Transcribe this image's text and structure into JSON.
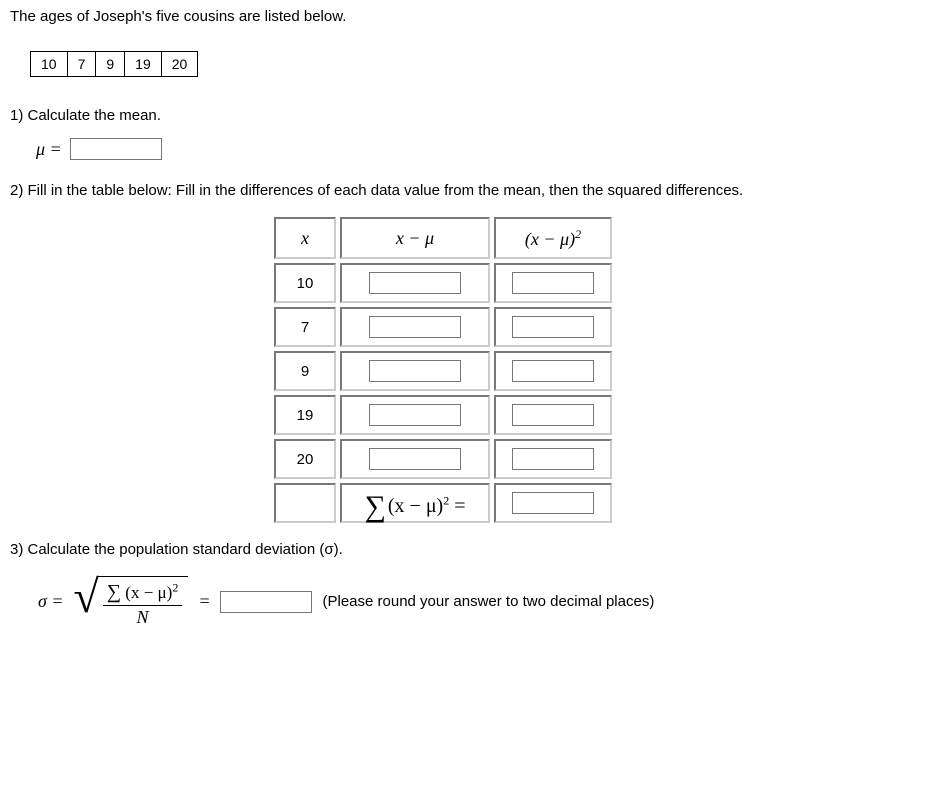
{
  "prompt": "The ages of Joseph's five cousins are listed below.",
  "data_values": [
    "10",
    "7",
    "9",
    "19",
    "20"
  ],
  "q1": {
    "label": "1) Calculate the mean.",
    "mu_label": "μ ="
  },
  "q2": {
    "label": "2) Fill in the table below: Fill in the differences of each data value from the mean, then the squared differences.",
    "headers": {
      "x": "x",
      "diff": "x − μ",
      "sq": "(x − μ)"
    },
    "sq_sup": "2",
    "rows": [
      "10",
      "7",
      "9",
      "19",
      "20"
    ],
    "sum_expr_prefix": "∑",
    "sum_expr_body": "(x − μ)",
    "sum_expr_sup": "2",
    "sum_expr_eq": " ="
  },
  "q3": {
    "label": "3) Calculate the population standard deviation (σ).",
    "sigma_lhs": "σ =",
    "sqrt": "√",
    "frac_num_prefix": "∑",
    "frac_num_body": "(x − μ)",
    "frac_num_sup": "2",
    "frac_den": "N",
    "eq": "=",
    "hint": "(Please round your answer to two decimal places)"
  }
}
